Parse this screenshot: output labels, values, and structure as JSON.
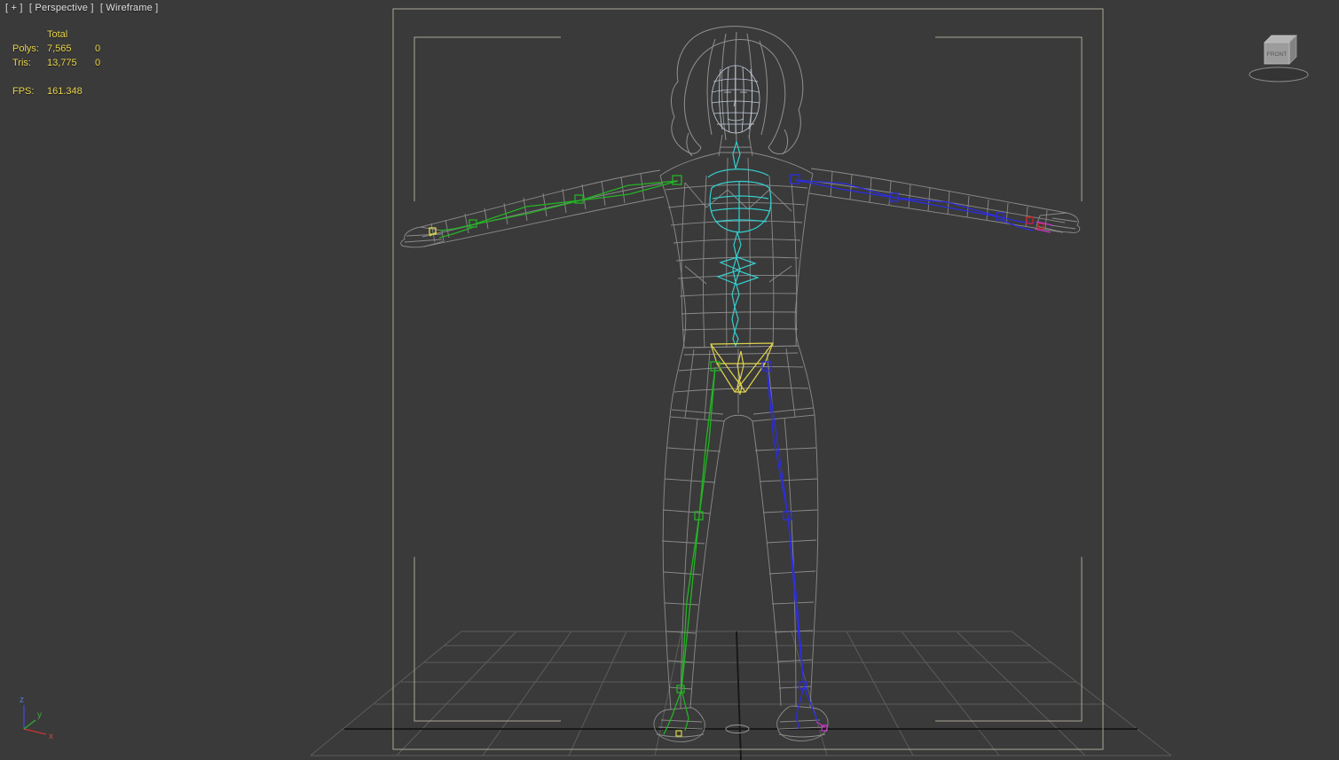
{
  "viewport": {
    "label_plus": "[ + ]",
    "label_view": "[ Perspective ]",
    "label_shading": "[ Wireframe ]"
  },
  "stats": {
    "header": "Total",
    "rows": [
      {
        "label": "Polys:",
        "value": "7,565",
        "delta": "0"
      },
      {
        "label": "Tris:",
        "value": "13,775",
        "delta": "0"
      }
    ],
    "fps_label": "FPS:",
    "fps_value": "161.348"
  },
  "viewcube": {
    "front_label": "FRONT"
  },
  "axis_tripod": {
    "x": "x",
    "y": "y",
    "z": "z"
  },
  "colors": {
    "viewport_bg": "#3a3a3a",
    "stats_text": "#e8d44a",
    "wireframe": "#9a9a9a",
    "face_mesh": "#c9d4e4",
    "safe_frame": "#b7b1a2",
    "bone_left_green": "#24b324",
    "bone_right_blue": "#2d2de0",
    "spine_cyan": "#35cfcf",
    "pelvis_yellow": "#e0d34d",
    "hand_red": "#cc2222",
    "hand_magenta": "#cc35cc"
  }
}
